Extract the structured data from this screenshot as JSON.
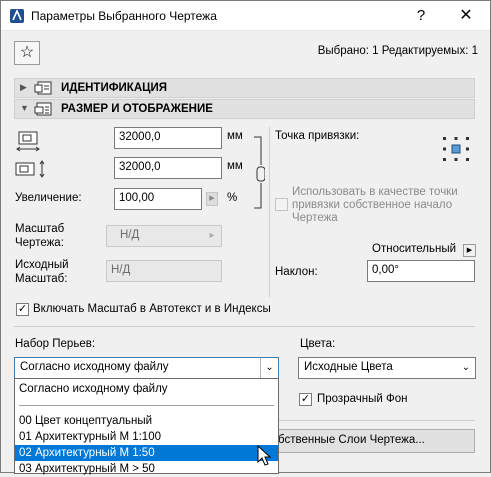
{
  "window": {
    "title": "Параметры Выбранного Чертежа",
    "help": "?",
    "close": "✕"
  },
  "toolbar": {
    "star": "☆",
    "selection_info": "Выбрано: 1 Редактируемых: 1"
  },
  "sections": {
    "identification": {
      "label": "ИДЕНТИФИКАЦИЯ",
      "arrow": "▶"
    },
    "size_display": {
      "label": "РАЗМЕР И ОТОБРАЖЕНИЕ",
      "arrow": "▼"
    }
  },
  "size": {
    "width_value": "32000,0",
    "height_value": "32000,0",
    "unit_mm": "мм",
    "zoom_label": "Увеличение:",
    "zoom_value": "100,00",
    "zoom_unit": "%",
    "scale_label_line1": "Масштаб",
    "scale_label_line2": "Чертежа:",
    "scale_value": "Н/Д",
    "orig_scale_line1": "Исходный",
    "orig_scale_line2": "Масштаб:",
    "orig_scale_value": "Н/Д"
  },
  "anchor": {
    "label": "Точка привязки:",
    "use_as_origin_line1": "Использовать в качестве точки",
    "use_as_origin_line2": "привязки собственное начало",
    "use_as_origin_line3": "Чертежа",
    "relative_label": "Относительный",
    "rotation_label": "Наклон:",
    "rotation_value": "0,00°"
  },
  "autotext": {
    "checked": true,
    "label": "Включать Масштаб в Автотекст и в Индексы"
  },
  "pens": {
    "label": "Набор Перьев:",
    "selected": "Согласно исходному файлу",
    "options": [
      "Согласно исходному файлу",
      "00 Цвет концептуальный",
      "01 Архитектурный М 1:100",
      "02 Архитектурный М 1:50",
      "03 Архитектурный М > 50"
    ],
    "highlighted_index": 3
  },
  "colors": {
    "label": "Цвета:",
    "selected": "Исходные Цвета"
  },
  "transparent_bg": {
    "checked": true,
    "label": "Прозрачный Фон"
  },
  "layers_button": {
    "label": "бственные Слои Чертежа..."
  },
  "accent": "#0078d7"
}
